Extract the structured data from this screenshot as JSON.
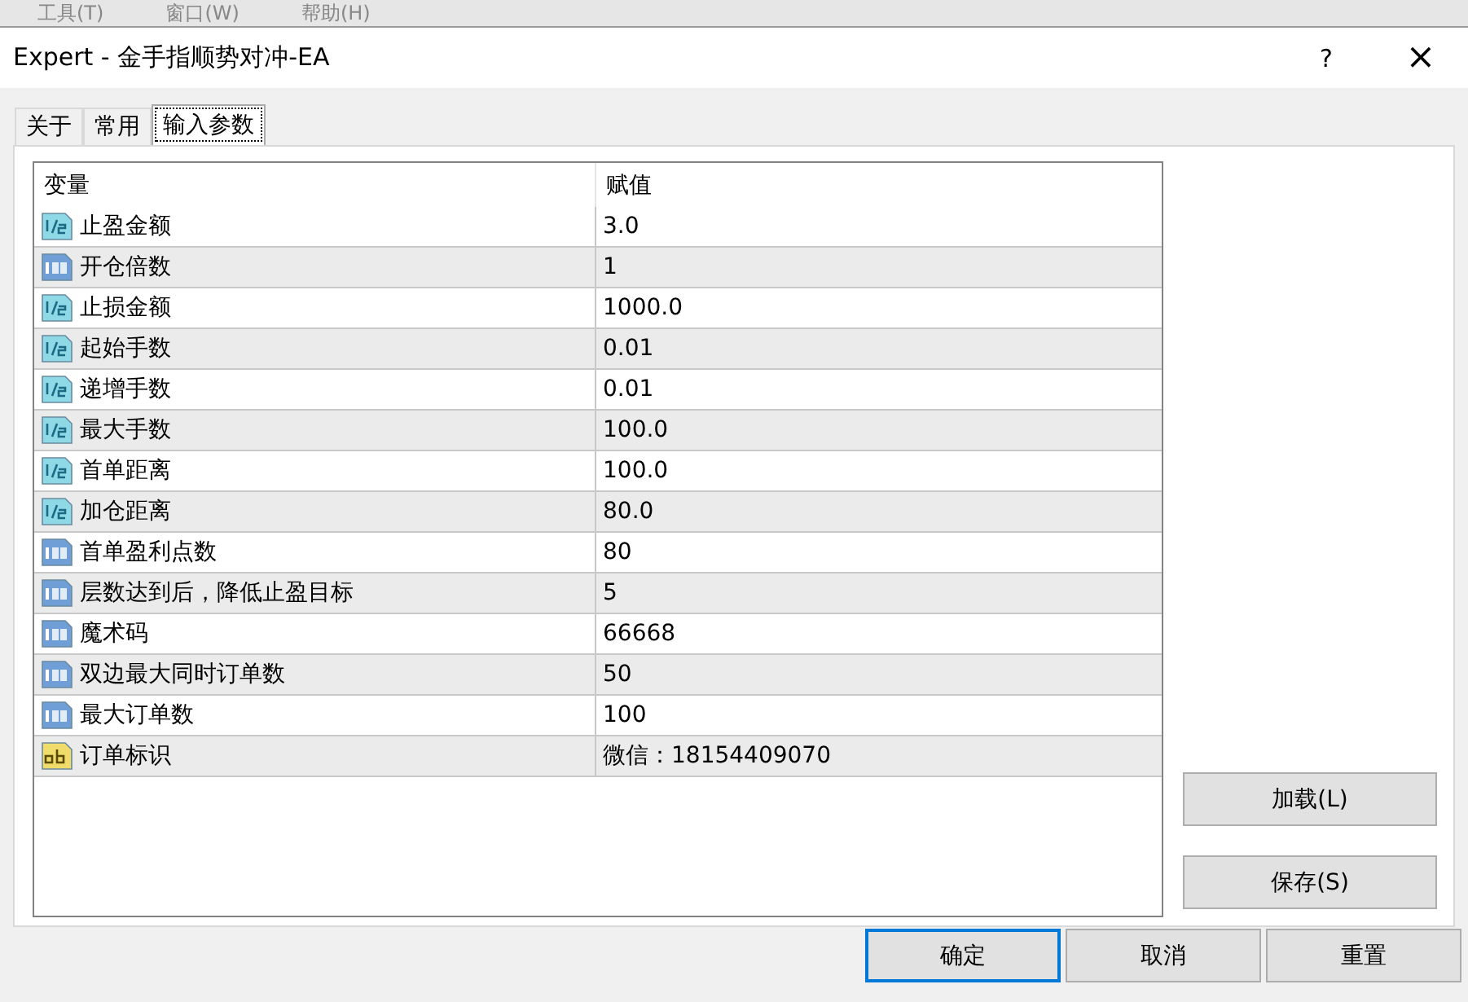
{
  "menu_bar": [
    "工具(T)",
    "窗口(W)",
    "帮助(H)"
  ],
  "window": {
    "title": "Expert - 金手指顺势对冲-EA",
    "help": "?",
    "close": "×"
  },
  "tabs": [
    {
      "label": "关于",
      "selected": false
    },
    {
      "label": "常用",
      "selected": false
    },
    {
      "label": "输入参数",
      "selected": true
    }
  ],
  "table": {
    "columns": [
      "变量",
      "赋值"
    ],
    "rows": [
      {
        "kind": "double",
        "name": "止盈金额",
        "value": "3.0"
      },
      {
        "kind": "int",
        "name": "开仓倍数",
        "value": "1"
      },
      {
        "kind": "double",
        "name": "止损金额",
        "value": "1000.0"
      },
      {
        "kind": "double",
        "name": "起始手数",
        "value": "0.01"
      },
      {
        "kind": "double",
        "name": "递增手数",
        "value": "0.01"
      },
      {
        "kind": "double",
        "name": "最大手数",
        "value": "100.0"
      },
      {
        "kind": "double",
        "name": "首单距离",
        "value": "100.0"
      },
      {
        "kind": "double",
        "name": "加仓距离",
        "value": "80.0"
      },
      {
        "kind": "int",
        "name": "首单盈利点数",
        "value": "80"
      },
      {
        "kind": "int",
        "name": "层数达到后，降低止盈目标",
        "value": "5"
      },
      {
        "kind": "int",
        "name": "魔术码",
        "value": "66668"
      },
      {
        "kind": "int",
        "name": "双边最大同时订单数",
        "value": "50"
      },
      {
        "kind": "int",
        "name": "最大订单数",
        "value": "100"
      },
      {
        "kind": "string",
        "name": "订单标识",
        "value": "微信：18154409070"
      }
    ]
  },
  "side_buttons": [
    "加载(L)",
    "保存(S)"
  ],
  "buttons": [
    {
      "label": "确定",
      "selected": true
    },
    {
      "label": "取消",
      "selected": false
    },
    {
      "label": "重置",
      "selected": false
    }
  ]
}
